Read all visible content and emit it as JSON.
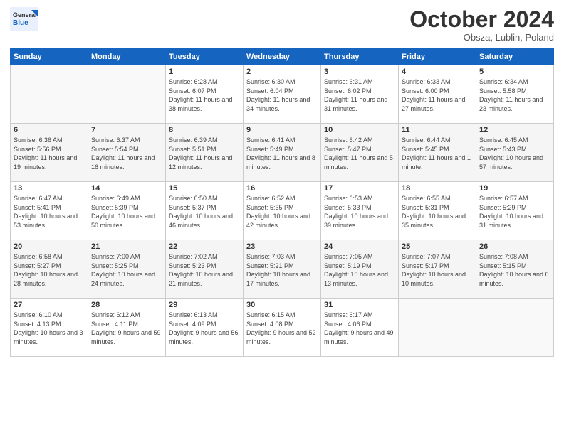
{
  "header": {
    "logo_general": "General",
    "logo_blue": "Blue",
    "month": "October 2024",
    "location": "Obsza, Lublin, Poland"
  },
  "days_of_week": [
    "Sunday",
    "Monday",
    "Tuesday",
    "Wednesday",
    "Thursday",
    "Friday",
    "Saturday"
  ],
  "weeks": [
    [
      {
        "day": "",
        "sunrise": "",
        "sunset": "",
        "daylight": ""
      },
      {
        "day": "",
        "sunrise": "",
        "sunset": "",
        "daylight": ""
      },
      {
        "day": "1",
        "sunrise": "Sunrise: 6:28 AM",
        "sunset": "Sunset: 6:07 PM",
        "daylight": "Daylight: 11 hours and 38 minutes."
      },
      {
        "day": "2",
        "sunrise": "Sunrise: 6:30 AM",
        "sunset": "Sunset: 6:04 PM",
        "daylight": "Daylight: 11 hours and 34 minutes."
      },
      {
        "day": "3",
        "sunrise": "Sunrise: 6:31 AM",
        "sunset": "Sunset: 6:02 PM",
        "daylight": "Daylight: 11 hours and 31 minutes."
      },
      {
        "day": "4",
        "sunrise": "Sunrise: 6:33 AM",
        "sunset": "Sunset: 6:00 PM",
        "daylight": "Daylight: 11 hours and 27 minutes."
      },
      {
        "day": "5",
        "sunrise": "Sunrise: 6:34 AM",
        "sunset": "Sunset: 5:58 PM",
        "daylight": "Daylight: 11 hours and 23 minutes."
      }
    ],
    [
      {
        "day": "6",
        "sunrise": "Sunrise: 6:36 AM",
        "sunset": "Sunset: 5:56 PM",
        "daylight": "Daylight: 11 hours and 19 minutes."
      },
      {
        "day": "7",
        "sunrise": "Sunrise: 6:37 AM",
        "sunset": "Sunset: 5:54 PM",
        "daylight": "Daylight: 11 hours and 16 minutes."
      },
      {
        "day": "8",
        "sunrise": "Sunrise: 6:39 AM",
        "sunset": "Sunset: 5:51 PM",
        "daylight": "Daylight: 11 hours and 12 minutes."
      },
      {
        "day": "9",
        "sunrise": "Sunrise: 6:41 AM",
        "sunset": "Sunset: 5:49 PM",
        "daylight": "Daylight: 11 hours and 8 minutes."
      },
      {
        "day": "10",
        "sunrise": "Sunrise: 6:42 AM",
        "sunset": "Sunset: 5:47 PM",
        "daylight": "Daylight: 11 hours and 5 minutes."
      },
      {
        "day": "11",
        "sunrise": "Sunrise: 6:44 AM",
        "sunset": "Sunset: 5:45 PM",
        "daylight": "Daylight: 11 hours and 1 minute."
      },
      {
        "day": "12",
        "sunrise": "Sunrise: 6:45 AM",
        "sunset": "Sunset: 5:43 PM",
        "daylight": "Daylight: 10 hours and 57 minutes."
      }
    ],
    [
      {
        "day": "13",
        "sunrise": "Sunrise: 6:47 AM",
        "sunset": "Sunset: 5:41 PM",
        "daylight": "Daylight: 10 hours and 53 minutes."
      },
      {
        "day": "14",
        "sunrise": "Sunrise: 6:49 AM",
        "sunset": "Sunset: 5:39 PM",
        "daylight": "Daylight: 10 hours and 50 minutes."
      },
      {
        "day": "15",
        "sunrise": "Sunrise: 6:50 AM",
        "sunset": "Sunset: 5:37 PM",
        "daylight": "Daylight: 10 hours and 46 minutes."
      },
      {
        "day": "16",
        "sunrise": "Sunrise: 6:52 AM",
        "sunset": "Sunset: 5:35 PM",
        "daylight": "Daylight: 10 hours and 42 minutes."
      },
      {
        "day": "17",
        "sunrise": "Sunrise: 6:53 AM",
        "sunset": "Sunset: 5:33 PM",
        "daylight": "Daylight: 10 hours and 39 minutes."
      },
      {
        "day": "18",
        "sunrise": "Sunrise: 6:55 AM",
        "sunset": "Sunset: 5:31 PM",
        "daylight": "Daylight: 10 hours and 35 minutes."
      },
      {
        "day": "19",
        "sunrise": "Sunrise: 6:57 AM",
        "sunset": "Sunset: 5:29 PM",
        "daylight": "Daylight: 10 hours and 31 minutes."
      }
    ],
    [
      {
        "day": "20",
        "sunrise": "Sunrise: 6:58 AM",
        "sunset": "Sunset: 5:27 PM",
        "daylight": "Daylight: 10 hours and 28 minutes."
      },
      {
        "day": "21",
        "sunrise": "Sunrise: 7:00 AM",
        "sunset": "Sunset: 5:25 PM",
        "daylight": "Daylight: 10 hours and 24 minutes."
      },
      {
        "day": "22",
        "sunrise": "Sunrise: 7:02 AM",
        "sunset": "Sunset: 5:23 PM",
        "daylight": "Daylight: 10 hours and 21 minutes."
      },
      {
        "day": "23",
        "sunrise": "Sunrise: 7:03 AM",
        "sunset": "Sunset: 5:21 PM",
        "daylight": "Daylight: 10 hours and 17 minutes."
      },
      {
        "day": "24",
        "sunrise": "Sunrise: 7:05 AM",
        "sunset": "Sunset: 5:19 PM",
        "daylight": "Daylight: 10 hours and 13 minutes."
      },
      {
        "day": "25",
        "sunrise": "Sunrise: 7:07 AM",
        "sunset": "Sunset: 5:17 PM",
        "daylight": "Daylight: 10 hours and 10 minutes."
      },
      {
        "day": "26",
        "sunrise": "Sunrise: 7:08 AM",
        "sunset": "Sunset: 5:15 PM",
        "daylight": "Daylight: 10 hours and 6 minutes."
      }
    ],
    [
      {
        "day": "27",
        "sunrise": "Sunrise: 6:10 AM",
        "sunset": "Sunset: 4:13 PM",
        "daylight": "Daylight: 10 hours and 3 minutes."
      },
      {
        "day": "28",
        "sunrise": "Sunrise: 6:12 AM",
        "sunset": "Sunset: 4:11 PM",
        "daylight": "Daylight: 9 hours and 59 minutes."
      },
      {
        "day": "29",
        "sunrise": "Sunrise: 6:13 AM",
        "sunset": "Sunset: 4:09 PM",
        "daylight": "Daylight: 9 hours and 56 minutes."
      },
      {
        "day": "30",
        "sunrise": "Sunrise: 6:15 AM",
        "sunset": "Sunset: 4:08 PM",
        "daylight": "Daylight: 9 hours and 52 minutes."
      },
      {
        "day": "31",
        "sunrise": "Sunrise: 6:17 AM",
        "sunset": "Sunset: 4:06 PM",
        "daylight": "Daylight: 9 hours and 49 minutes."
      },
      {
        "day": "",
        "sunrise": "",
        "sunset": "",
        "daylight": ""
      },
      {
        "day": "",
        "sunrise": "",
        "sunset": "",
        "daylight": ""
      }
    ]
  ]
}
